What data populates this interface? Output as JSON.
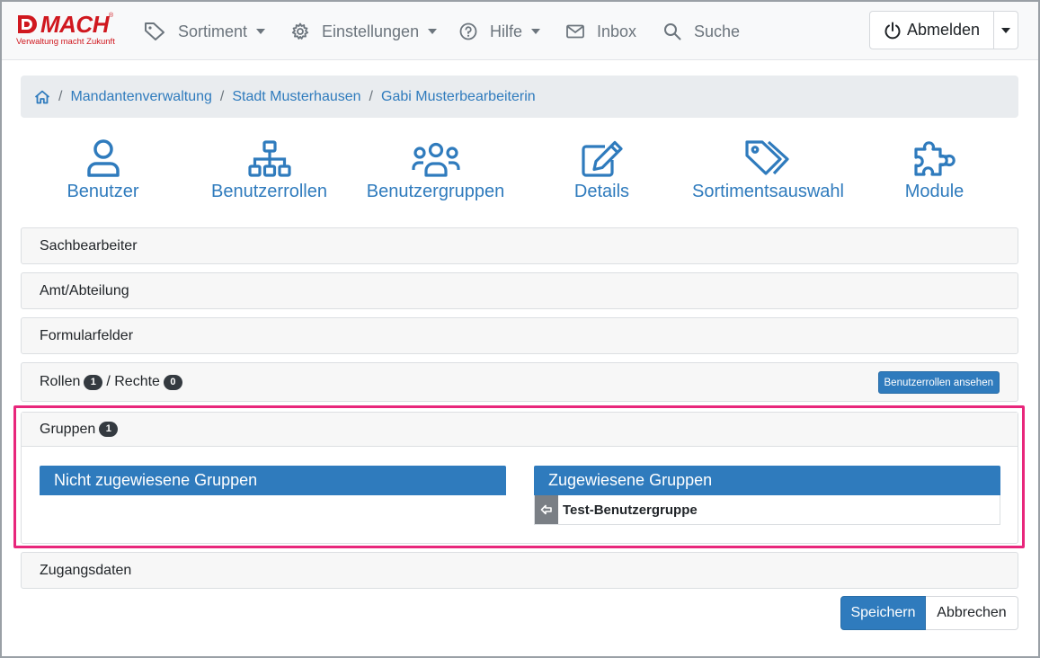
{
  "brand": {
    "name": "MACH",
    "registered": "®",
    "slogan": "Verwaltung macht Zukunft",
    "color": "#d0181f"
  },
  "nav": {
    "items": [
      {
        "label": "Sortiment",
        "icon": "tag-icon",
        "dropdown": true
      },
      {
        "label": "Einstellungen",
        "icon": "gear-icon",
        "dropdown": true
      },
      {
        "label": "Hilfe",
        "icon": "question-circle-icon",
        "dropdown": true
      },
      {
        "label": "Inbox",
        "icon": "envelope-icon",
        "dropdown": false
      },
      {
        "label": "Suche",
        "icon": "search-icon",
        "dropdown": false
      }
    ],
    "logout_label": "Abmelden"
  },
  "breadcrumb": {
    "home_icon": "home-icon",
    "items": [
      "Mandantenverwaltung",
      "Stadt Musterhausen",
      "Gabi Musterbearbeiterin"
    ]
  },
  "tiles": [
    {
      "label": "Benutzer",
      "icon": "user-icon"
    },
    {
      "label": "Benutzerrollen",
      "icon": "sitemap-icon"
    },
    {
      "label": "Benutzergruppen",
      "icon": "users-icon"
    },
    {
      "label": "Details",
      "icon": "edit-icon"
    },
    {
      "label": "Sortimentsauswahl",
      "icon": "tags-icon"
    },
    {
      "label": "Module",
      "icon": "puzzle-icon"
    }
  ],
  "sections": {
    "sachbearbeiter": "Sachbearbeiter",
    "amt": "Amt/Abteilung",
    "formularfelder": "Formularfelder",
    "rollen": {
      "label": "Rollen",
      "count": "1",
      "separator": "/ Rechte",
      "rechte_count": "0",
      "button": "Benutzerrollen ansehen"
    },
    "gruppen": {
      "label": "Gruppen",
      "count": "1",
      "unassigned_title": "Nicht zugewiesene Gruppen",
      "assigned_title": "Zugewiesene Gruppen",
      "assigned_items": [
        "Test-Benutzergruppe"
      ]
    },
    "zugangsdaten": "Zugangsdaten"
  },
  "actions": {
    "save": "Speichern",
    "cancel": "Abbrechen"
  },
  "colors": {
    "accent": "#2f7bbd",
    "highlight": "#e8267b"
  }
}
